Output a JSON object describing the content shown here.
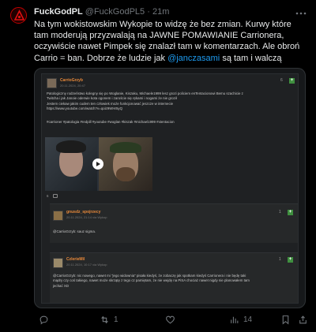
{
  "tweet": {
    "display_name": "FuckGodPL",
    "handle": "@FuckGodPL5",
    "separator": "·",
    "time": "21m",
    "text_part1": "Na tym wokistowskim Wykopie to widzę że bez zmian. Kurwy które tam moderują przyzwalają na JAWNE POMAWIANIE Carrionera, oczywiście nawet Pimpek się znalazł tam w komentarzach. Ale obroń Carrio = ban. Dobrze że ludzie jak ",
    "mention": "@janczasami",
    "text_part2": " są tam i walczą",
    "more_icon": "more-horizontal-icon"
  },
  "embedded_post": {
    "author": "CarrioGrzyb",
    "date": "20.11.2024, 20:47",
    "text_lines": [
      "Patologiczny rodzeństwo kolegny się po Woglanie, Kiszaku, Michaele1999 lesz grozi policiem enTentacionowi Bemu szachicie z",
      "Twitcha i jak Janoie oderwie kota ogonem i zaroście się rękami i nogami że nie groził",
      "Jestem ciekaw jakim cudem ten człowiek może funkcjonować jeszcze w internecie",
      "https://www.youtube.com/watch?v=qoiz9WHr5yQ"
    ],
    "tags": "#carrioner #patologia #redpill #youtube #woglan #kiszak #michael1999 #xtentacion",
    "vote_count": "6",
    "vote_icon": "plus-icon",
    "comment_icon": "comment-icon",
    "play_icon": "play-icon"
  },
  "replies": [
    {
      "author": "gnusdz_spojrzecy",
      "date": "20.11.2024, 21:14",
      "source": "via Wykop",
      "text": "@CarrioGrzyb: sauz sigma.",
      "vote_count": "1"
    },
    {
      "author": "CzlerieMil",
      "date": "20.11.2024, 10:17",
      "source": "via Wykop",
      "text_lines": [
        "@CarrioGrzyb: nic nowego, nawet mi \"jego widownia\" pisała kiedyś, że zobaczę jak spotkam kiedyś Carrionera i nie będę taki",
        "mądry czy coś takiego, nawet może skrzątę z tego cz pamiętam, że nie wejdę na PiSA chociaż nawet nigdy nie planowałem tam",
        "jechać XD"
      ],
      "vote_count": "1"
    }
  ],
  "actions": {
    "reply_count": "",
    "retweet_count": "1",
    "like_count": "",
    "view_count": "14"
  },
  "colors": {
    "background": "#000000",
    "text": "#e7e9ea",
    "muted": "#71767b",
    "link": "#1d9bf0",
    "wykop_orange": "#e8893a",
    "wykop_green": "#3f8f3f"
  }
}
